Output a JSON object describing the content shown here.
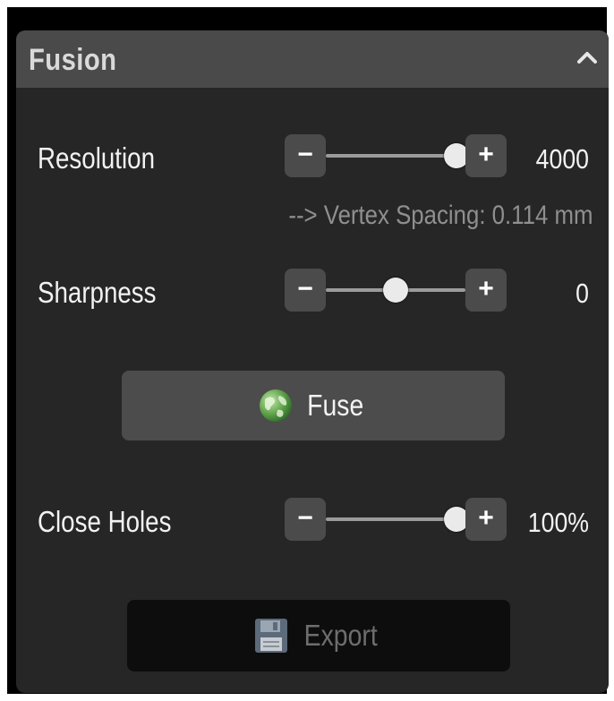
{
  "panel": {
    "title": "Fusion",
    "collapse_icon": "chevron-up-icon"
  },
  "resolution": {
    "label": "Resolution",
    "value": "4000",
    "level": 1.0,
    "minus": "−",
    "plus": "+",
    "note": "--> Vertex Spacing: 0.114 mm"
  },
  "sharpness": {
    "label": "Sharpness",
    "value": "0",
    "level": 0.5,
    "minus": "−",
    "plus": "+"
  },
  "fuse_button": {
    "label": "Fuse",
    "icon": "globe-icon"
  },
  "close_holes": {
    "label": "Close Holes",
    "value": "100%",
    "level": 1.0,
    "minus": "−",
    "plus": "+"
  },
  "export_button": {
    "label": "Export",
    "icon": "floppy-disk-icon",
    "enabled": false
  },
  "colors": {
    "panel_bg": "#262626",
    "header_bg": "#4a4a4a",
    "button_bg": "#4c4c4c",
    "disabled_text": "#6e6e6e"
  }
}
